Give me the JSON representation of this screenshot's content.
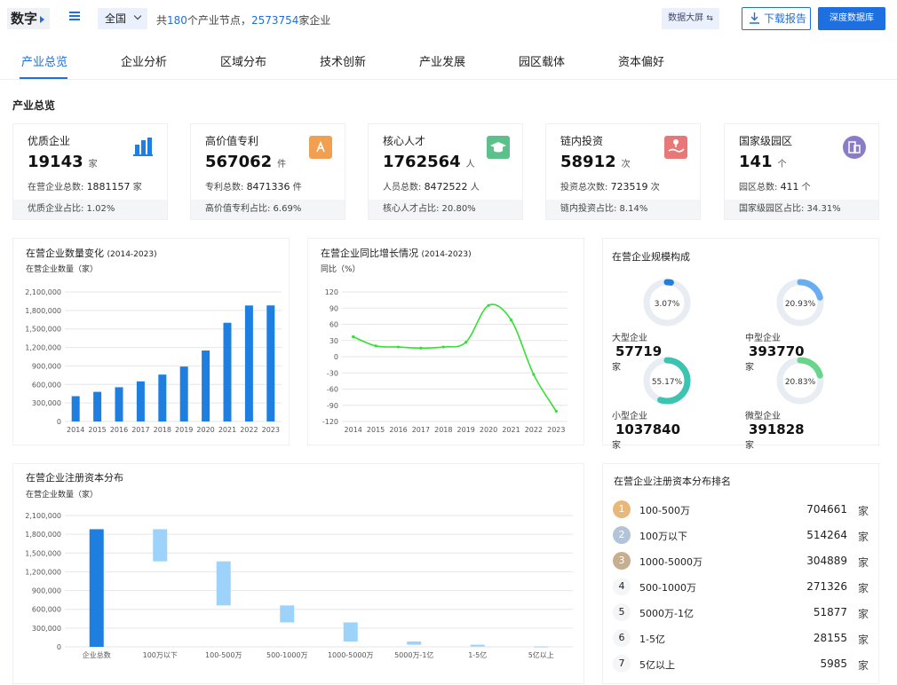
{
  "header": {
    "logo": "数字",
    "region": "全国",
    "summary_prefix": "共",
    "node_count": "180",
    "summary_mid": "个产业节点，",
    "company_count": "2573754",
    "summary_suffix": "家企业",
    "big_screen": "数据大屏",
    "download": "下载报告",
    "deep_db": "深度数据库"
  },
  "tabs": [
    "产业总览",
    "企业分析",
    "区域分布",
    "技术创新",
    "产业发展",
    "园区载体",
    "资本偏好"
  ],
  "section_title": "产业总览",
  "cards": [
    {
      "label": "优质企业",
      "value": "19143",
      "unit": "家",
      "sub_label": "在营企业总数:",
      "sub_value": "1881157",
      "sub_unit": "家",
      "foot": "优质企业占比: 1.02%",
      "icon": "building-chart-icon",
      "color": "#1e7fe0"
    },
    {
      "label": "高价值专利",
      "value": "567062",
      "unit": "件",
      "sub_label": "专利总数:",
      "sub_value": "8471336",
      "sub_unit": "件",
      "foot": "高价值专利占比: 6.69%",
      "icon": "patent-icon",
      "color": "#f0a050"
    },
    {
      "label": "核心人才",
      "value": "1762564",
      "unit": "人",
      "sub_label": "人员总数:",
      "sub_value": "8472522",
      "sub_unit": "人",
      "foot": "核心人才占比: 20.80%",
      "icon": "graduation-cap-icon",
      "color": "#5cc08a"
    },
    {
      "label": "链内投资",
      "value": "58912",
      "unit": "次",
      "sub_label": "投资总次数:",
      "sub_value": "723519",
      "sub_unit": "次",
      "foot": "链内投资占比: 8.14%",
      "icon": "investment-hand-icon",
      "color": "#e87878"
    },
    {
      "label": "国家级园区",
      "value": "141",
      "unit": "个",
      "sub_label": "园区总数:",
      "sub_value": "411",
      "sub_unit": "个",
      "foot": "国家级园区占比: 34.31%",
      "icon": "park-building-icon",
      "color": "#8c7cc8"
    }
  ],
  "chart_titles": {
    "count": "在营企业数量变化",
    "count_years": "(2014-2023)",
    "count_unit": "在营企业数量（家）",
    "growth": "在营企业同比增长情况",
    "growth_years": "(2014-2023)",
    "growth_unit": "同比（%）",
    "scale": "在营企业规模构成",
    "capital": "在营企业注册资本分布",
    "capital_unit": "在营企业数量（家）",
    "rank": "在营企业注册资本分布排名"
  },
  "chart_data": [
    {
      "type": "bar",
      "title": "在营企业数量变化 (2014-2023)",
      "ylabel": "在营企业数量（家）",
      "categories": [
        "2014",
        "2015",
        "2016",
        "2017",
        "2018",
        "2019",
        "2020",
        "2021",
        "2022",
        "2023"
      ],
      "values": [
        410000,
        480000,
        555000,
        650000,
        760000,
        890000,
        1150000,
        1600000,
        1880000,
        1881157
      ],
      "yticks": [
        "0",
        "300,000",
        "600,000",
        "900,000",
        "1,200,000",
        "1,500,000",
        "1,800,000",
        "2,100,000"
      ],
      "ylim": [
        0,
        2100000
      ],
      "color": "#1e7fe0"
    },
    {
      "type": "line",
      "title": "在营企业同比增长情况 (2014-2023)",
      "ylabel": "同比（%）",
      "categories": [
        "2014",
        "2015",
        "2016",
        "2017",
        "2018",
        "2019",
        "2020",
        "2021",
        "2022",
        "2023"
      ],
      "values": [
        37,
        20,
        18,
        16,
        18,
        27,
        95,
        68,
        -33,
        -101
      ],
      "yticks": [
        "-120",
        "-90",
        "-60",
        "-30",
        "0",
        "30",
        "60",
        "90",
        "120"
      ],
      "ylim": [
        -120,
        120
      ],
      "color": "#33e033"
    },
    {
      "type": "pie",
      "title": "在营企业规模构成",
      "slices": [
        {
          "name": "大型企业",
          "count": "57719",
          "unit": "家",
          "percent": 3.07,
          "label": "3.07%",
          "color": "#1e7fe0"
        },
        {
          "name": "中型企业",
          "count": "393770",
          "unit": "家",
          "percent": 20.93,
          "label": "20.93%",
          "color": "#66aef0"
        },
        {
          "name": "小型企业",
          "count": "1037840",
          "unit": "家",
          "percent": 55.17,
          "label": "55.17%",
          "color": "#3cc4b0"
        },
        {
          "name": "微型企业",
          "count": "391828",
          "unit": "家",
          "percent": 20.83,
          "label": "20.83%",
          "color": "#6ad48a"
        }
      ]
    },
    {
      "type": "bar",
      "title": "在营企业注册资本分布",
      "ylabel": "在营企业数量（家）",
      "categories": [
        "企业总数",
        "100万以下",
        "100-500万",
        "500-1000万",
        "1000-5000万",
        "5000万-1亿",
        "1-5亿",
        "5亿以上"
      ],
      "values": [
        1881157,
        514264,
        704661,
        271326,
        304889,
        51877,
        28155,
        5985
      ],
      "yticks": [
        "0",
        "300,000",
        "600,000",
        "900,000",
        "1,200,000",
        "1,500,000",
        "1,800,000",
        "2,100,000"
      ],
      "ylim": [
        0,
        2100000
      ],
      "color": "#1e7fe0",
      "segment_color": "#9dd2fa"
    }
  ],
  "ranking": [
    {
      "rank": "1",
      "name": "100-500万",
      "value": "704661",
      "unit": "家",
      "color": "#e8b87a"
    },
    {
      "rank": "2",
      "name": "100万以下",
      "value": "514264",
      "unit": "家",
      "color": "#b4c4d8"
    },
    {
      "rank": "3",
      "name": "1000-5000万",
      "value": "304889",
      "unit": "家",
      "color": "#c8ae90"
    },
    {
      "rank": "4",
      "name": "500-1000万",
      "value": "271326",
      "unit": "家",
      "color": ""
    },
    {
      "rank": "5",
      "name": "5000万-1亿",
      "value": "51877",
      "unit": "家",
      "color": ""
    },
    {
      "rank": "6",
      "name": "1-5亿",
      "value": "28155",
      "unit": "家",
      "color": ""
    },
    {
      "rank": "7",
      "name": "5亿以上",
      "value": "5985",
      "unit": "家",
      "color": ""
    }
  ]
}
